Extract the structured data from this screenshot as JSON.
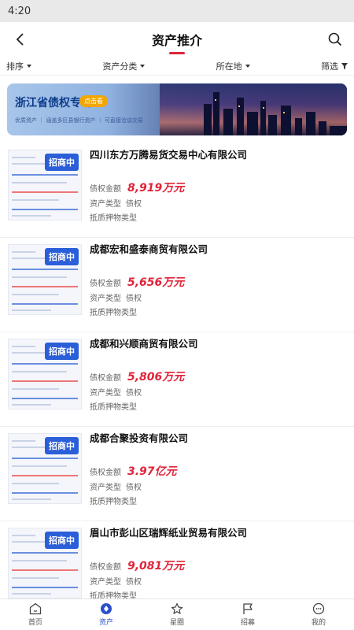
{
  "status": {
    "time": "4:20"
  },
  "nav": {
    "title": "资产推介"
  },
  "filters": [
    {
      "label": "排序"
    },
    {
      "label": "资产分类"
    },
    {
      "label": "所在地"
    },
    {
      "label": "筛选"
    }
  ],
  "banner": {
    "title": "浙江省债权专场",
    "badge": "点击看",
    "subtitle": "优质资产 ｜ 涵盖多区县银行资产 ｜ 可直接洽谈交易"
  },
  "assets": [
    {
      "tag": "招商中",
      "company": "四川东方万腾易货交易中心有限公司",
      "amount_label": "债权金额",
      "amount": "8,919万元",
      "type_label": "资产类型",
      "type": "债权",
      "collateral_label": "抵质押物类型"
    },
    {
      "tag": "招商中",
      "company": "成都宏和盛泰商贸有限公司",
      "amount_label": "债权金额",
      "amount": "5,656万元",
      "type_label": "资产类型",
      "type": "债权",
      "collateral_label": "抵质押物类型"
    },
    {
      "tag": "招商中",
      "company": "成都和兴顺商贸有限公司",
      "amount_label": "债权金额",
      "amount": "5,806万元",
      "type_label": "资产类型",
      "type": "债权",
      "collateral_label": "抵质押物类型"
    },
    {
      "tag": "招商中",
      "company": "成都合聚投资有限公司",
      "amount_label": "债权金额",
      "amount": "3.97亿元",
      "type_label": "资产类型",
      "type": "债权",
      "collateral_label": "抵质押物类型"
    },
    {
      "tag": "招商中",
      "company": "眉山市彭山区瑞辉纸业贸易有限公司",
      "amount_label": "债权金额",
      "amount": "9,081万元",
      "type_label": "资产类型",
      "type": "债权",
      "collateral_label": "抵质押物类型"
    }
  ],
  "tabbar": [
    {
      "label": "首页",
      "icon": "home-icon"
    },
    {
      "label": "资产",
      "icon": "asset-icon",
      "active": true
    },
    {
      "label": "星圈",
      "icon": "star-icon"
    },
    {
      "label": "招募",
      "icon": "flag-icon"
    },
    {
      "label": "我的",
      "icon": "profile-icon"
    }
  ],
  "colors": {
    "accent": "#e0243a",
    "brand": "#2b4fc9",
    "tag": "#2b5fd9"
  }
}
